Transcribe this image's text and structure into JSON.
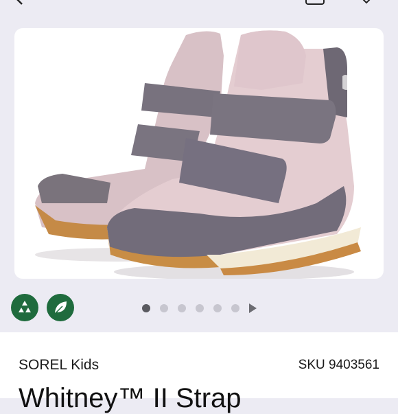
{
  "header": {
    "back_icon": "chevron-left-icon",
    "bag_icon": "shopping-bag-icon",
    "favorite_icon": "heart-icon"
  },
  "gallery": {
    "image_alt": "SOREL Kids Whitney II Strap boot",
    "image_count": 6,
    "active_index": 0,
    "next_icon": "play-triangle-icon"
  },
  "badges": [
    {
      "icon": "recycle-icon",
      "color": "#1f6b3d"
    },
    {
      "icon": "leaf-icon",
      "color": "#1f6b3d"
    }
  ],
  "product": {
    "brand": "SOREL Kids",
    "sku": "SKU 9403561",
    "title": "Whitney™ II Strap"
  }
}
